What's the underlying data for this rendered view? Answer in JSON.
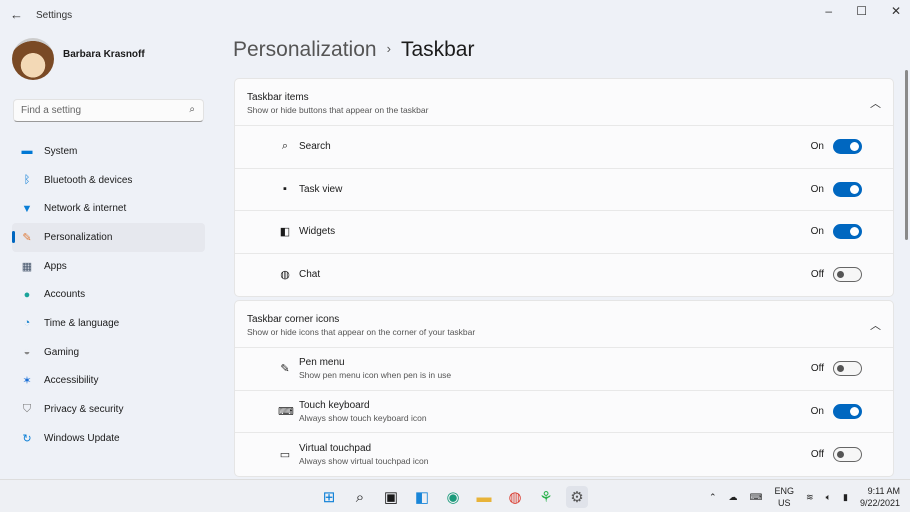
{
  "window": {
    "title": "Settings",
    "back_icon": "back-arrow-icon"
  },
  "user": {
    "name": "Barbara Krasnoff"
  },
  "search": {
    "placeholder": "Find a setting"
  },
  "nav": [
    {
      "label": "System",
      "icon": "system-icon",
      "color": "#0078d4"
    },
    {
      "label": "Bluetooth & devices",
      "icon": "bluetooth-icon",
      "color": "#0078d4"
    },
    {
      "label": "Network & internet",
      "icon": "wifi-icon",
      "color": "#0a7ed6"
    },
    {
      "label": "Personalization",
      "icon": "brush-icon",
      "color": "#e07b39",
      "active": true
    },
    {
      "label": "Apps",
      "icon": "apps-icon",
      "color": "#44546a"
    },
    {
      "label": "Accounts",
      "icon": "accounts-icon",
      "color": "#1aa39a"
    },
    {
      "label": "Time & language",
      "icon": "globe-clock-icon",
      "color": "#1d86d0"
    },
    {
      "label": "Gaming",
      "icon": "gamepad-icon",
      "color": "#888"
    },
    {
      "label": "Accessibility",
      "icon": "accessibility-icon",
      "color": "#1a6fd6"
    },
    {
      "label": "Privacy & security",
      "icon": "shield-icon",
      "color": "#777"
    },
    {
      "label": "Windows Update",
      "icon": "update-icon",
      "color": "#0a7ed6"
    }
  ],
  "breadcrumb": {
    "parent": "Personalization",
    "current": "Taskbar"
  },
  "sections": [
    {
      "title": "Taskbar items",
      "subtitle": "Show or hide buttons that appear on the taskbar",
      "items": [
        {
          "label": "Search",
          "state": "On",
          "icon": "search-icon"
        },
        {
          "label": "Task view",
          "state": "On",
          "icon": "task-view-icon"
        },
        {
          "label": "Widgets",
          "state": "On",
          "icon": "widgets-icon"
        },
        {
          "label": "Chat",
          "state": "Off",
          "icon": "chat-icon"
        }
      ]
    },
    {
      "title": "Taskbar corner icons",
      "subtitle": "Show or hide icons that appear on the corner of your taskbar",
      "items": [
        {
          "label": "Pen menu",
          "desc": "Show pen menu icon when pen is in use",
          "state": "Off",
          "icon": "pen-icon"
        },
        {
          "label": "Touch keyboard",
          "desc": "Always show touch keyboard icon",
          "state": "On",
          "icon": "keyboard-icon"
        },
        {
          "label": "Virtual touchpad",
          "desc": "Always show virtual touchpad icon",
          "state": "Off",
          "icon": "touchpad-icon"
        }
      ]
    }
  ],
  "taskbar": {
    "lang": "ENG",
    "region": "US",
    "time": "9:11 AM",
    "date": "9/22/2021"
  }
}
